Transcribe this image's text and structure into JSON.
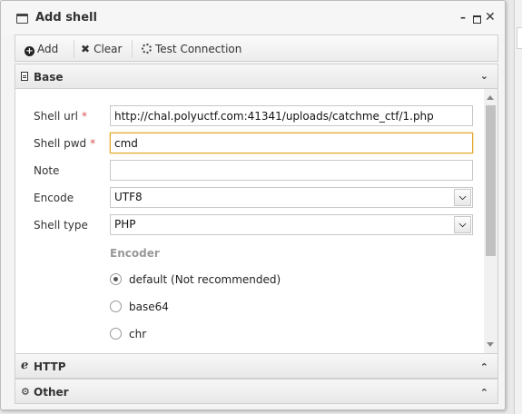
{
  "window": {
    "title": "Add shell",
    "controls": {
      "minimize": "–",
      "close": "✕"
    }
  },
  "toolbar": {
    "add_label": "Add",
    "clear_label": "Clear",
    "test_label": "Test Connection"
  },
  "panels": {
    "base": {
      "label": "Base",
      "state": "expanded"
    },
    "http": {
      "label": "HTTP",
      "state": "collapsed"
    },
    "other": {
      "label": "Other",
      "state": "collapsed"
    }
  },
  "form": {
    "shell_url": {
      "label": "Shell url",
      "required_mark": "*",
      "value": "http://chal.polyuctf.com:41341/uploads/catchme_ctf/1.php"
    },
    "shell_pwd": {
      "label": "Shell pwd",
      "required_mark": "*",
      "value": "cmd"
    },
    "note": {
      "label": "Note",
      "value": ""
    },
    "encode": {
      "label": "Encode",
      "value": "UTF8"
    },
    "shell_type": {
      "label": "Shell type",
      "value": "PHP"
    },
    "encoder": {
      "label": "Encoder",
      "options": [
        {
          "label": "default (Not recommended)",
          "checked": true
        },
        {
          "label": "base64",
          "checked": false
        },
        {
          "label": "chr",
          "checked": false
        }
      ]
    }
  },
  "icons": {
    "window": "window-icon",
    "add": "plus-circle-icon",
    "clear": "x-icon",
    "test": "spinner-icon",
    "base": "document-icon",
    "http": "http-icon",
    "other": "gears-icon"
  },
  "colors": {
    "required": "#d9534f",
    "focus_border": "#e0a82e",
    "encoder_label": "#999999"
  }
}
